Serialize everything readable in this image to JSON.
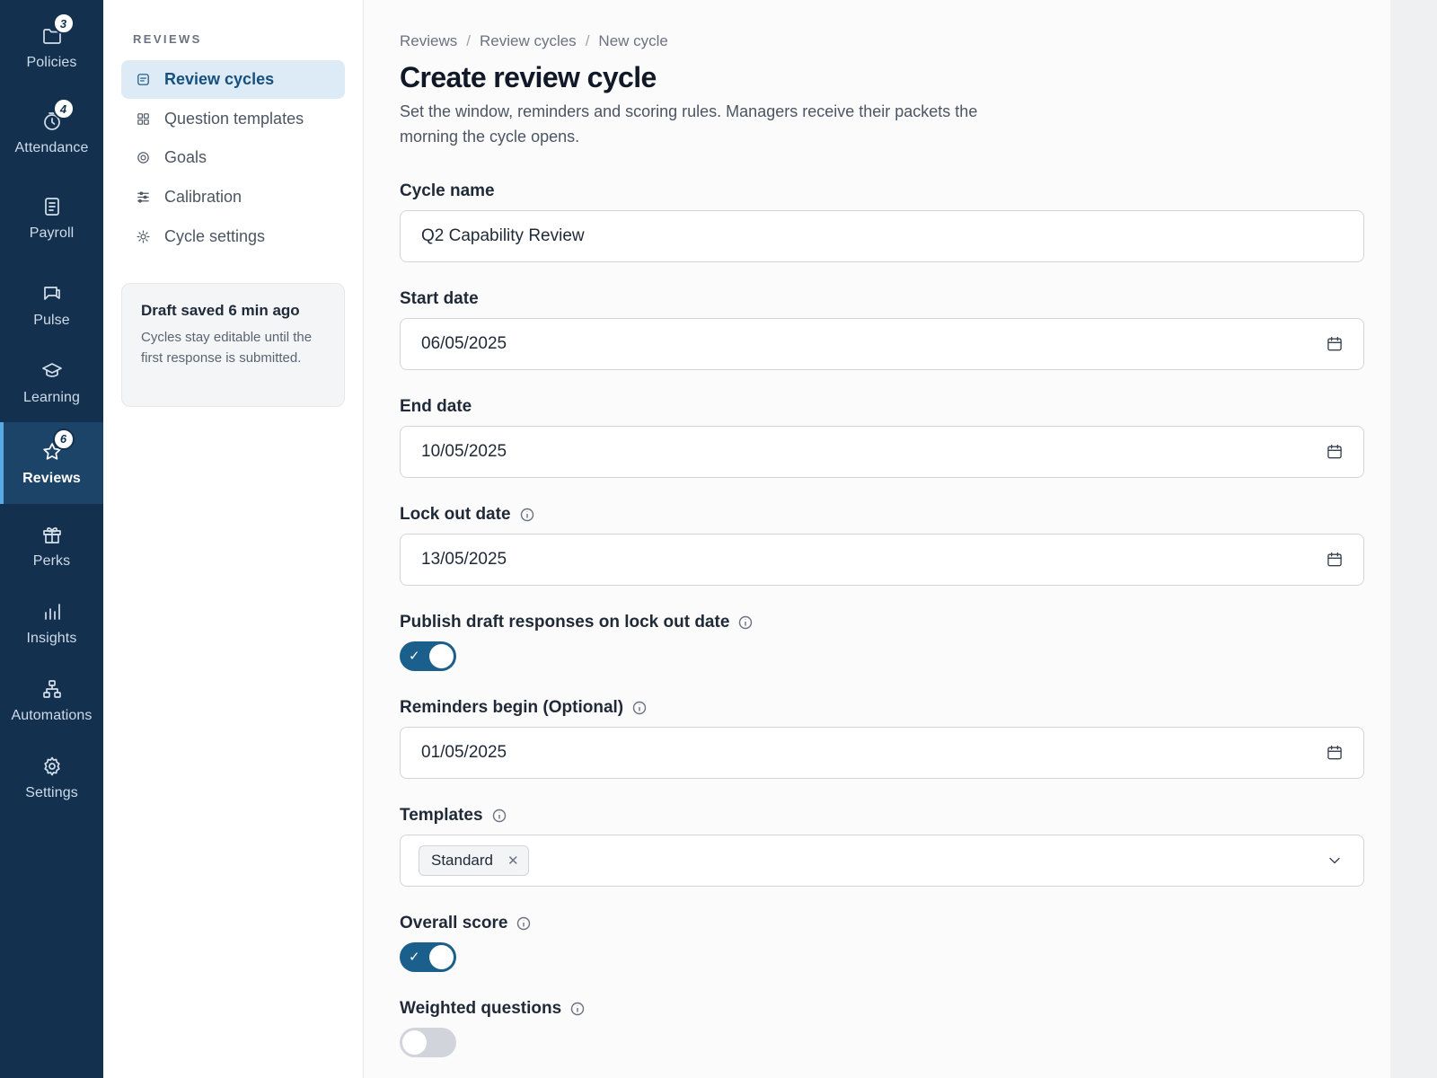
{
  "rail": {
    "items": [
      {
        "label": "Policies",
        "icon": "folder-icon",
        "badge": "3"
      },
      {
        "label": "Attendance",
        "icon": "clock-icon",
        "badge": "4"
      },
      {
        "label": "Payroll",
        "icon": "document-icon"
      },
      {
        "label": "Pulse",
        "icon": "chat-flag-icon"
      },
      {
        "label": "Learning",
        "icon": "graduation-cap-icon"
      },
      {
        "label": "Reviews",
        "icon": "star-icon",
        "badge": "6",
        "active": true
      },
      {
        "label": "Perks",
        "icon": "gift-icon"
      },
      {
        "label": "Insights",
        "icon": "bar-chart-icon"
      },
      {
        "label": "Automations",
        "icon": "flow-icon"
      },
      {
        "label": "Settings",
        "icon": "gear-icon"
      }
    ]
  },
  "subnav": {
    "title": "REVIEWS",
    "items": [
      {
        "label": "Review cycles",
        "icon": "list-doc-icon",
        "active": true
      },
      {
        "label": "Question templates",
        "icon": "grid-icon"
      },
      {
        "label": "Goals",
        "icon": "target-icon"
      },
      {
        "label": "Calibration",
        "icon": "sliders-icon"
      },
      {
        "label": "Cycle settings",
        "icon": "sun-gear-icon"
      }
    ],
    "draft_card": {
      "title": "Draft saved 6 min ago",
      "body": "Cycles stay editable until the first response is submitted."
    }
  },
  "breadcrumb": [
    "Reviews",
    "Review cycles",
    "New cycle"
  ],
  "breadcrumb_sep": "/",
  "page": {
    "title": "Create review cycle",
    "subtitle": "Set the window, reminders and scoring rules. Managers receive their packets the morning the cycle opens."
  },
  "form": {
    "cycle_name": {
      "label": "Cycle name",
      "value": "Q2 Capability Review"
    },
    "start_date": {
      "label": "Start date",
      "value": "06/05/2025"
    },
    "end_date": {
      "label": "End date",
      "value": "10/05/2025"
    },
    "lock_out_date": {
      "label": "Lock out date",
      "value": "13/05/2025"
    },
    "publish_drafts": {
      "label": "Publish draft responses on lock out date",
      "on": true
    },
    "reminders_begin": {
      "label": "Reminders begin (Optional)",
      "value": "01/05/2025"
    },
    "templates": {
      "label": "Templates",
      "selected": [
        "Standard"
      ]
    },
    "overall_score": {
      "label": "Overall score",
      "on": true
    },
    "weighted_questions": {
      "label": "Weighted questions",
      "on": false
    }
  },
  "colors": {
    "rail_bg": "#13314f",
    "rail_active": "#1c4468",
    "accent": "#1b5f8c",
    "subnav_active_bg": "#dcebf5"
  }
}
